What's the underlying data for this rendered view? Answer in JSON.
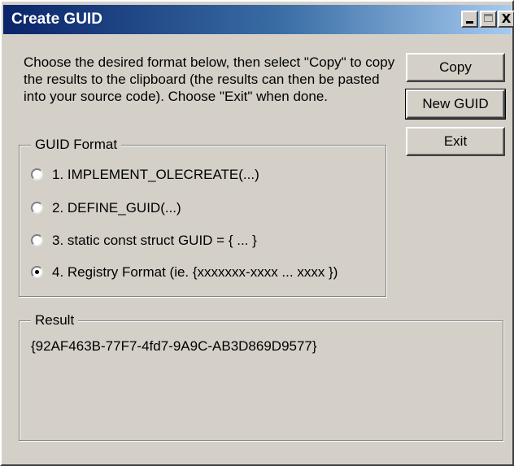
{
  "window": {
    "title": "Create GUID",
    "controls": {
      "minimize": "_",
      "maximize": "□",
      "close": "X"
    }
  },
  "instructions": "Choose the desired format below, then select \"Copy\" to copy the results to the clipboard (the results can then be pasted into your source code).  Choose \"Exit\" when done.",
  "buttons": {
    "copy": "Copy",
    "new_guid": "New GUID",
    "exit": "Exit"
  },
  "guid_format": {
    "label": "GUID Format",
    "options": [
      {
        "label": "1. IMPLEMENT_OLECREATE(...)",
        "selected": false
      },
      {
        "label": "2. DEFINE_GUID(...)",
        "selected": false
      },
      {
        "label": "3. static const struct GUID = { ... }",
        "selected": false
      },
      {
        "label": "4. Registry Format (ie. {xxxxxxx-xxxx ... xxxx })",
        "selected": true
      }
    ]
  },
  "result": {
    "label": "Result",
    "value": "{92AF463B-77F7-4fd7-9A9C-AB3D869D9577}"
  }
}
